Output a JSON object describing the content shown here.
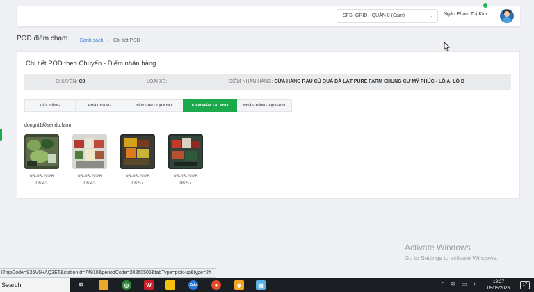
{
  "header": {
    "store_select_value": "SFS- GRID - QUẬN 8 (Cam)",
    "user_name": "Ngân Phạm Thị Kim"
  },
  "page": {
    "title": "POD điểm chạm",
    "breadcrumb": {
      "link": "Danh sách",
      "separator": "›",
      "current": "Chi tiết POD"
    }
  },
  "detail": {
    "title": "Chi tiết POD theo Chuyến - Điểm nhận hàng",
    "trip_label": "CHUYẾN:",
    "trip_value": "C9",
    "vehicle_label": "LOẠI XE:",
    "vehicle_value": "",
    "receive_label": "ĐIỂM NHẬN HÀNG:",
    "receive_value": "CỬA HÀNG RAU CỦ QUẢ ĐÀ LẠT PURE FARM CHUNG CƯ MỸ PHÚC - LÔ A, LÔ B"
  },
  "tabs": [
    {
      "label": "LẤY HÀNG",
      "active": false
    },
    {
      "label": "PHÁT HÀNG",
      "active": false
    },
    {
      "label": "BÀN GIAO TẠI KHO",
      "active": false
    },
    {
      "label": "KIỂM ĐẾM TẠI KHO",
      "active": true
    },
    {
      "label": "NHẬN HÀNG TẠI GRID",
      "active": false
    }
  ],
  "photos_section": {
    "email": "dongnt1@sendo.farm",
    "photos": [
      {
        "date": "05-05-2026",
        "time": "06:43"
      },
      {
        "date": "05-05-2026",
        "time": "06:43"
      },
      {
        "date": "05-05-2026",
        "time": "06:57"
      },
      {
        "date": "05-05-2026",
        "time": "06:57"
      }
    ]
  },
  "watermark": {
    "line1": "Activate Windows",
    "line2": "Go to Settings to activate Windows."
  },
  "status_url": "l?tripCode=S26V5HAQ3ET&stationId=74910&periodCode=20260505&tabType=pick-up&type=2#",
  "taskbar": {
    "search_text": "Search",
    "time": "18:27",
    "date": "05/05/2026",
    "notification_count": "17"
  }
}
